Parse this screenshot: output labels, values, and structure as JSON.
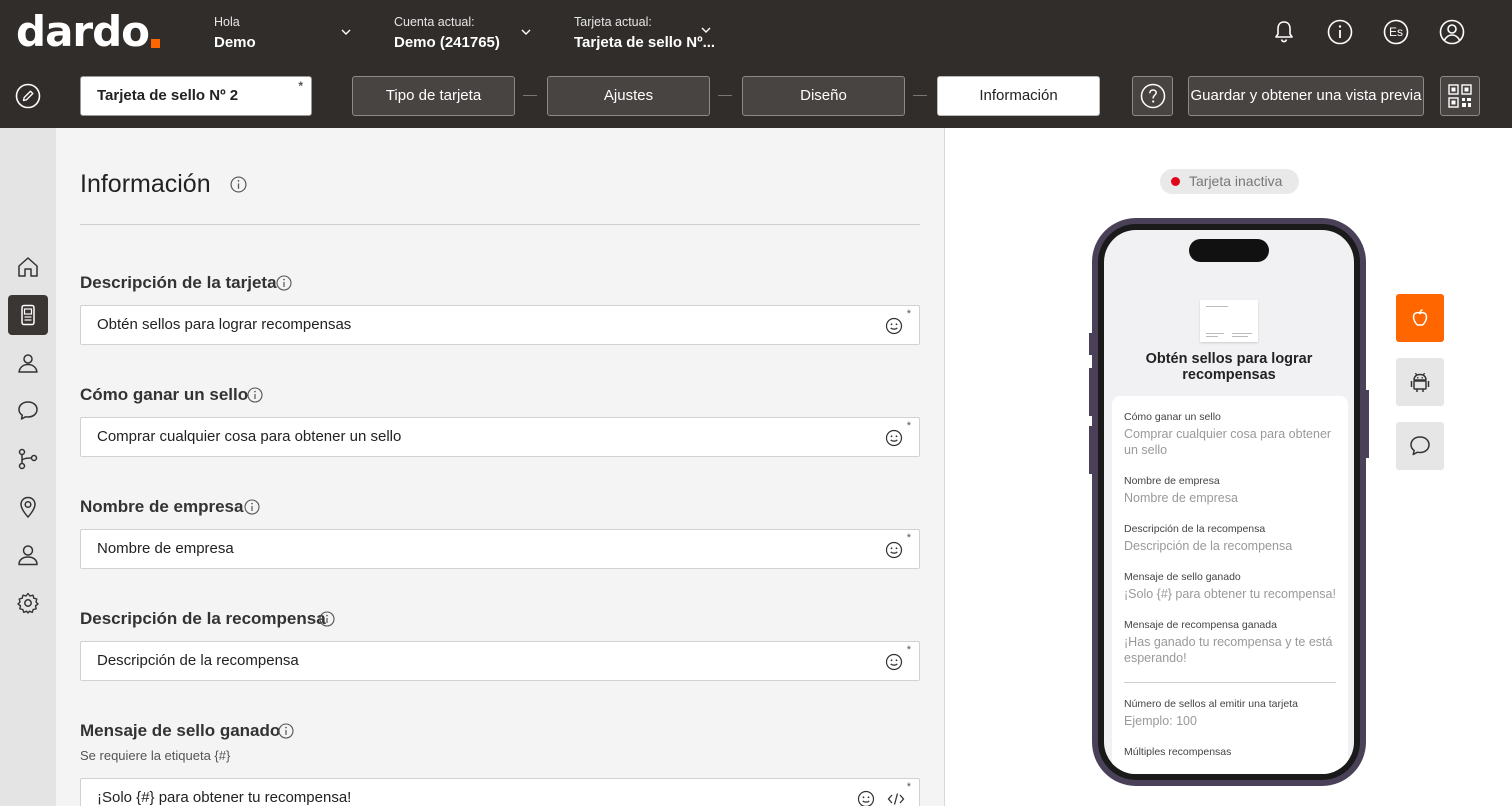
{
  "brand": {
    "logo_text": "dardo",
    "accent": "#ff6600"
  },
  "header": {
    "greeting_label": "Hola",
    "greeting_value": "Demo",
    "account_label": "Cuenta actual:",
    "account_value": "Demo (241765)",
    "card_label": "Tarjeta actual:",
    "card_value": "Tarjeta de sello Nº...",
    "lang_badge": "Es",
    "icons": [
      "bell-icon",
      "info-icon",
      "language-icon",
      "user-icon"
    ]
  },
  "toolbar": {
    "card_name": "Tarjeta de sello Nº 2",
    "required_mark": "*",
    "steps": [
      "Tipo de tarjeta",
      "Ajustes",
      "Diseño",
      "Información"
    ],
    "active_step": "Información",
    "save_label": "Guardar y obtener una vista previa"
  },
  "sidebar": {
    "items": [
      "home-icon",
      "card-icon",
      "clients-icon",
      "messages-icon",
      "flows-icon",
      "location-icon",
      "users-icon",
      "settings-icon"
    ],
    "active": "card-icon"
  },
  "form": {
    "title": "Información",
    "fields": [
      {
        "label": "Descripción de la tarjeta",
        "value": "Obtén sellos para lograr recompensas",
        "required": "*"
      },
      {
        "label": "Cómo ganar un sello",
        "value": "Comprar cualquier cosa para obtener un sello",
        "required": "*"
      },
      {
        "label": "Nombre de empresa",
        "value": "Nombre de empresa",
        "required": "*"
      },
      {
        "label": "Descripción de la recompensa",
        "value": "Descripción de la recompensa",
        "required": "*"
      },
      {
        "label": "Mensaje de sello ganado",
        "subtitle": "Se requiere la etiqueta {#}",
        "value": "¡Solo {#} para obtener tu recompensa!",
        "required": "*"
      }
    ]
  },
  "preview": {
    "status": "Tarjeta inactiva",
    "status_color": "#e0061a",
    "phone_title": "Obtén sellos para lograr recompensas",
    "items": [
      {
        "label": "Cómo ganar un sello",
        "value": "Comprar cualquier cosa para obtener un sello"
      },
      {
        "label": "Nombre de empresa",
        "value": "Nombre de empresa"
      },
      {
        "label": "Descripción de la recompensa",
        "value": "Descripción de la recompensa"
      },
      {
        "label": "Mensaje de sello ganado",
        "value": "¡Solo {#} para obtener tu recompensa!"
      },
      {
        "label": "Mensaje de recompensa ganada",
        "value": "¡Has ganado tu recompensa y te está esperando!"
      }
    ],
    "extra": [
      {
        "label": "Número de sellos al emitir una tarjeta",
        "value": "Ejemplo: 100"
      },
      {
        "label": "Múltiples recompensas",
        "value": ""
      }
    ],
    "platforms": [
      "apple-icon",
      "android-icon",
      "chat-icon"
    ],
    "platform_active_color": "#ff6600"
  }
}
